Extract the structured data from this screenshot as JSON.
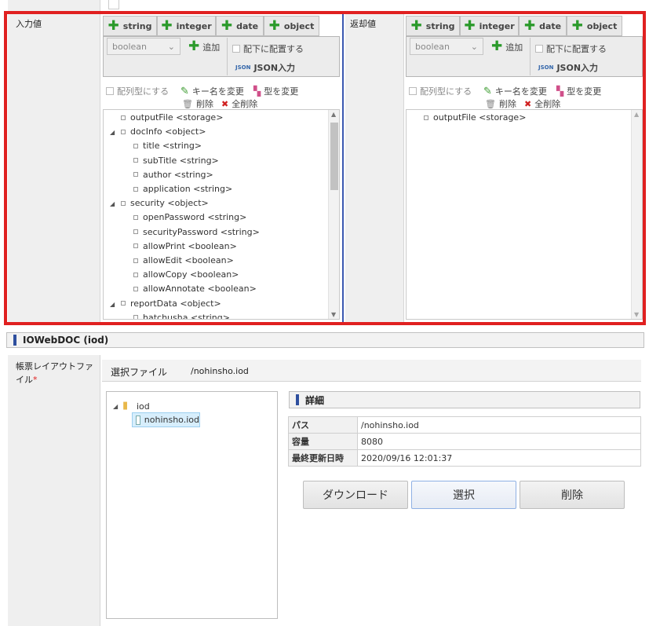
{
  "input_section": {
    "label": "入力値",
    "tabs": [
      "string",
      "integer",
      "date",
      "object"
    ],
    "type_select": "boolean",
    "add_label": "追加",
    "place_below_label": "配下に配置する",
    "json_label": "JSON入力",
    "array_label": "配列型にする",
    "rename_label": "キー名を変更",
    "change_type_label": "型を変更",
    "delete_label": "削除",
    "delete_all_label": "全削除",
    "tree": [
      {
        "text": "outputFile <storage>",
        "level": 0,
        "expand": false
      },
      {
        "text": "docInfo <object>",
        "level": 0,
        "expand": true
      },
      {
        "text": "title <string>",
        "level": 1,
        "expand": false
      },
      {
        "text": "subTitle <string>",
        "level": 1,
        "expand": false
      },
      {
        "text": "author <string>",
        "level": 1,
        "expand": false
      },
      {
        "text": "application <string>",
        "level": 1,
        "expand": false
      },
      {
        "text": "security <object>",
        "level": 0,
        "expand": true
      },
      {
        "text": "openPassword <string>",
        "level": 1,
        "expand": false
      },
      {
        "text": "securityPassword <string>",
        "level": 1,
        "expand": false
      },
      {
        "text": "allowPrint <boolean>",
        "level": 1,
        "expand": false
      },
      {
        "text": "allowEdit <boolean>",
        "level": 1,
        "expand": false
      },
      {
        "text": "allowCopy <boolean>",
        "level": 1,
        "expand": false
      },
      {
        "text": "allowAnnotate <boolean>",
        "level": 1,
        "expand": false
      },
      {
        "text": "reportData <object>",
        "level": 0,
        "expand": true
      },
      {
        "text": "hatchusha <string>",
        "level": 1,
        "expand": false
      }
    ]
  },
  "return_section": {
    "label": "返却値",
    "tabs": [
      "string",
      "integer",
      "date",
      "object"
    ],
    "type_select": "boolean",
    "add_label": "追加",
    "place_below_label": "配下に配置する",
    "json_label": "JSON入力",
    "array_label": "配列型にする",
    "rename_label": "キー名を変更",
    "change_type_label": "型を変更",
    "delete_label": "削除",
    "delete_all_label": "全削除",
    "tree": [
      {
        "text": "outputFile <storage>",
        "level": 0,
        "expand": false
      }
    ]
  },
  "iowebdoc": {
    "header": "IOWebDOC (iod)",
    "layout_label": "帳票レイアウトファイル",
    "required_mark": "*",
    "selected_file_label": "選択ファイル",
    "selected_file_value": "/nohinsho.iod",
    "folder_name": "iod",
    "file_name": "nohinsho.iod",
    "details_header": "詳細",
    "details": [
      {
        "key": "パス",
        "value": "/nohinsho.iod"
      },
      {
        "key": "容量",
        "value": "8080"
      },
      {
        "key": "最終更新日時",
        "value": "2020/09/16 12:01:37"
      }
    ],
    "download_label": "ダウンロード",
    "select_label": "選択",
    "delete_label": "削除"
  },
  "colors": {
    "accent": "#e02020",
    "header_mark": "#2e4f9e",
    "plus": "#2b9a2b"
  }
}
